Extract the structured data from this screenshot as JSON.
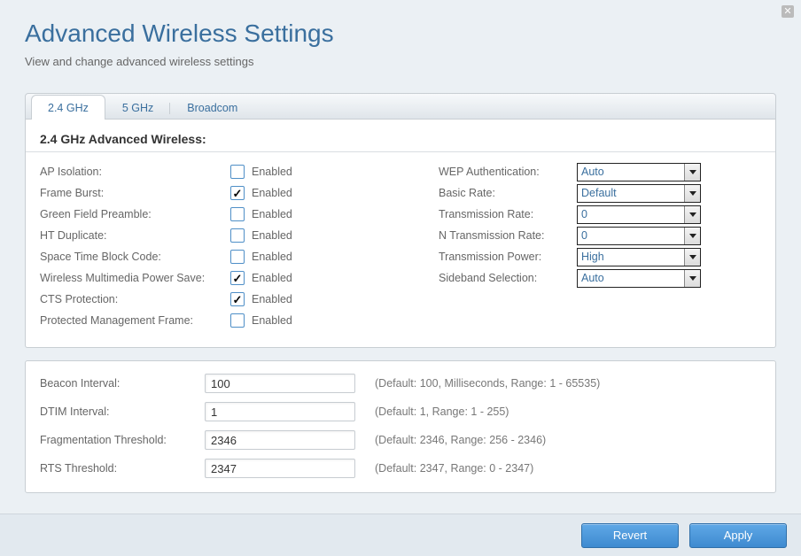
{
  "header": {
    "title": "Advanced Wireless Settings",
    "subtitle": "View and change advanced wireless settings"
  },
  "tabs": [
    {
      "label": "2.4 GHz",
      "active": true
    },
    {
      "label": "5 GHz",
      "active": false
    },
    {
      "label": "Broadcom",
      "active": false
    }
  ],
  "section_title": "2.4 GHz Advanced Wireless:",
  "checkbox_enabled_label": "Enabled",
  "left_checks": [
    {
      "label": "AP Isolation:",
      "checked": false
    },
    {
      "label": "Frame Burst:",
      "checked": true
    },
    {
      "label": "Green Field Preamble:",
      "checked": false
    },
    {
      "label": "HT Duplicate:",
      "checked": false
    },
    {
      "label": "Space Time Block Code:",
      "checked": false
    },
    {
      "label": "Wireless Multimedia Power Save:",
      "checked": true
    },
    {
      "label": "CTS Protection:",
      "checked": true
    },
    {
      "label": "Protected Management Frame:",
      "checked": false
    }
  ],
  "right_selects": [
    {
      "label": "WEP Authentication:",
      "value": "Auto"
    },
    {
      "label": "Basic Rate:",
      "value": "Default"
    },
    {
      "label": "Transmission Rate:",
      "value": "0"
    },
    {
      "label": "N Transmission Rate:",
      "value": "0"
    },
    {
      "label": "Transmission Power:",
      "value": "High"
    },
    {
      "label": "Sideband Selection:",
      "value": "Auto"
    }
  ],
  "numeric_rows": [
    {
      "label": "Beacon Interval:",
      "value": "100",
      "hint": "(Default: 100, Milliseconds, Range: 1 - 65535)"
    },
    {
      "label": "DTIM Interval:",
      "value": "1",
      "hint": "(Default: 1, Range: 1 - 255)"
    },
    {
      "label": "Fragmentation Threshold:",
      "value": "2346",
      "hint": "(Default: 2346, Range: 256 - 2346)"
    },
    {
      "label": "RTS Threshold:",
      "value": "2347",
      "hint": "(Default: 2347, Range: 0 - 2347)"
    }
  ],
  "buttons": {
    "revert": "Revert",
    "apply": "Apply"
  }
}
